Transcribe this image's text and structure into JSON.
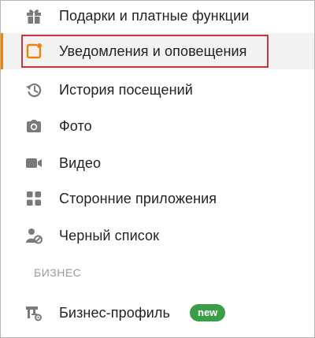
{
  "menu": {
    "items": [
      {
        "label": "Подарки и платные функции",
        "icon": "gift-icon"
      },
      {
        "label": "Уведомления и оповещения",
        "icon": "notification-icon",
        "active": true
      },
      {
        "label": "История посещений",
        "icon": "history-icon"
      },
      {
        "label": "Фото",
        "icon": "camera-icon"
      },
      {
        "label": "Видео",
        "icon": "video-camera-icon"
      },
      {
        "label": "Сторонние приложения",
        "icon": "apps-grid-icon"
      },
      {
        "label": "Черный список",
        "icon": "blocked-user-icon"
      }
    ],
    "business_section": {
      "header": "БИЗНЕС",
      "items": [
        {
          "label": "Бизнес-профиль",
          "icon": "business-profile-icon",
          "badge": "new"
        }
      ]
    }
  },
  "colors": {
    "accent": "#ee8208",
    "highlight_border": "#c9343e",
    "badge_green": "#3a9e46",
    "icon_gray": "#7a7a7a",
    "text": "#222222",
    "muted": "#9a9a9a"
  }
}
